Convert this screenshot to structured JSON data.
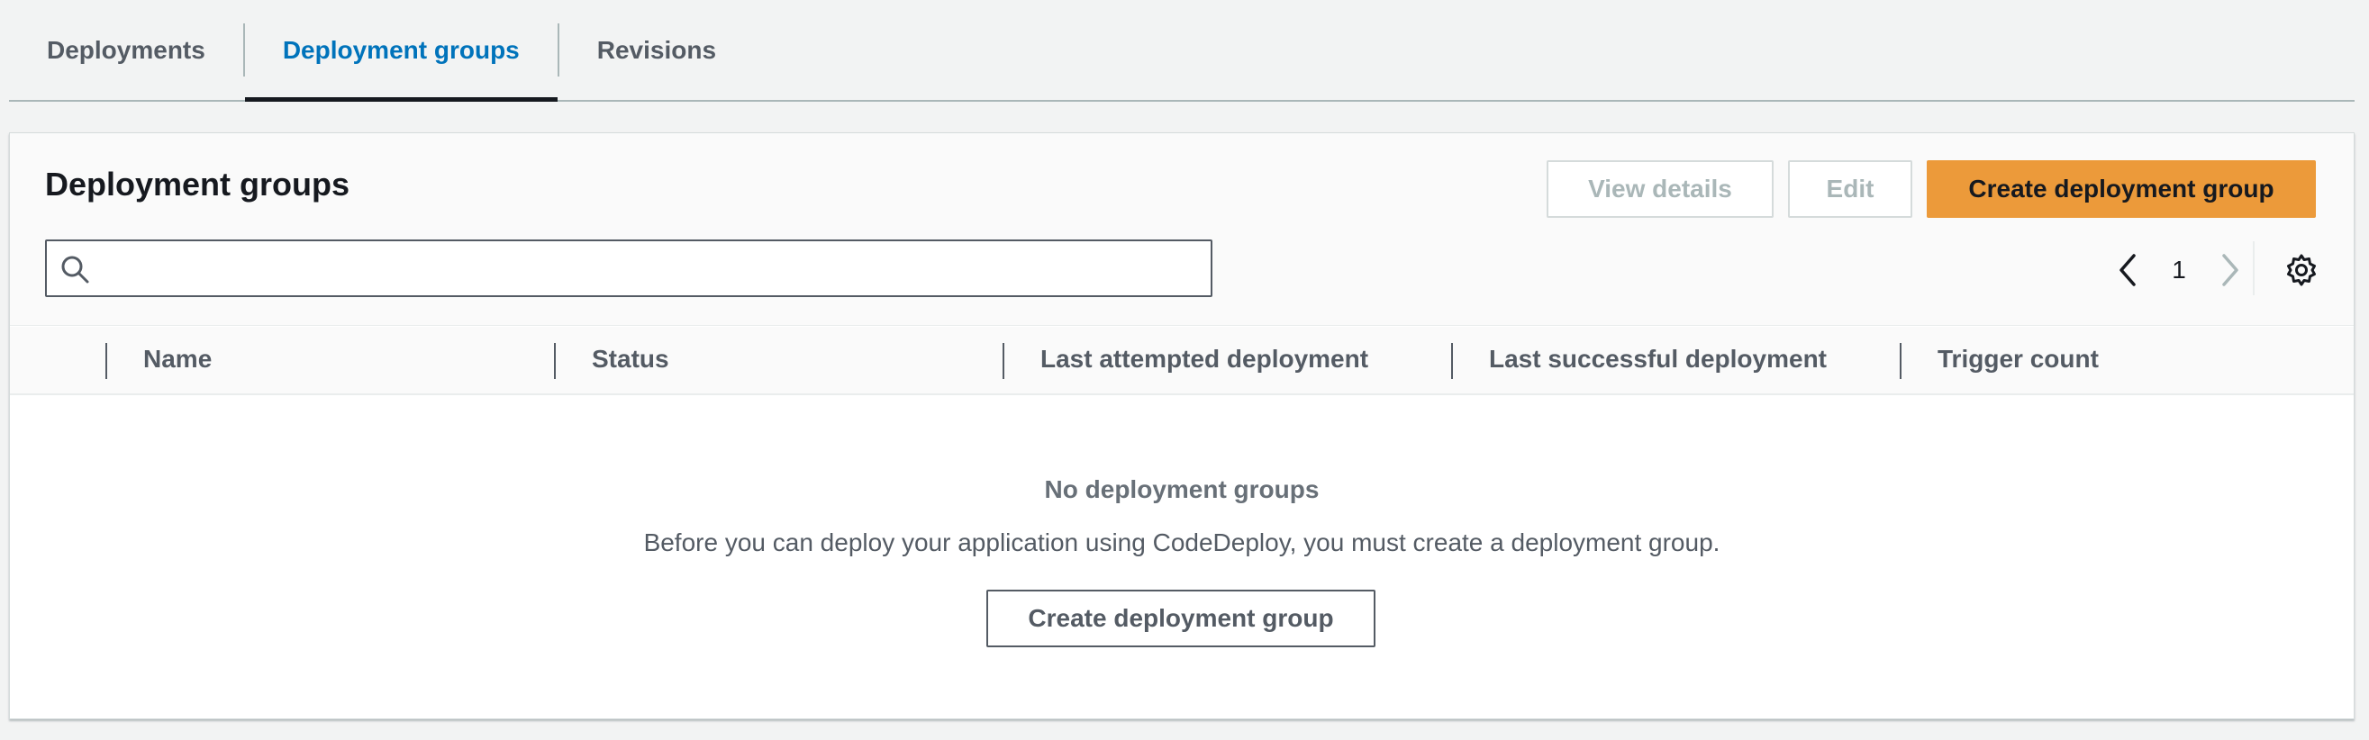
{
  "tabs": [
    {
      "label": "Deployments",
      "active": false
    },
    {
      "label": "Deployment groups",
      "active": true
    },
    {
      "label": "Revisions",
      "active": false
    }
  ],
  "panel": {
    "title": "Deployment groups",
    "buttons": {
      "view_details": "View details",
      "edit": "Edit",
      "create": "Create deployment group"
    },
    "search": {
      "value": "",
      "placeholder": ""
    },
    "pagination": {
      "current_page": "1"
    }
  },
  "table": {
    "columns": [
      "Name",
      "Status",
      "Last attempted deployment",
      "Last successful deployment",
      "Trigger count"
    ]
  },
  "empty_state": {
    "title": "No deployment groups",
    "description": "Before you can deploy your application using CodeDeploy, you must create a deployment group.",
    "button": "Create deployment group"
  },
  "colors": {
    "primary_button": "#ec9a3a",
    "active_tab": "#0073bb",
    "page_background": "#f2f3f3"
  },
  "icons": {
    "search": "search-icon",
    "prev_page": "chevron-left-icon",
    "next_page": "chevron-right-icon",
    "settings": "gear-icon"
  }
}
